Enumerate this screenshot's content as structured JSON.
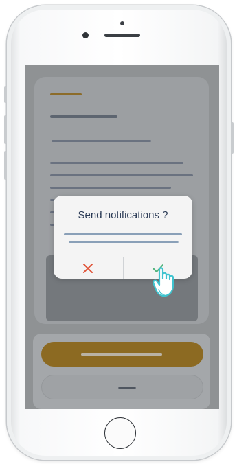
{
  "device": {
    "type": "smartphone",
    "frame_color": "#f2f3f4",
    "screen_overlay_color": "#8f9294"
  },
  "dialog": {
    "title": "Send notifications ?",
    "cancel_icon": "close-icon",
    "confirm_icon": "check-icon",
    "cancel_color": "#e0553a",
    "confirm_color": "#4fb27a"
  },
  "pointer": {
    "icon": "hand-pointer-icon",
    "color": "#3fc3cf"
  },
  "background_screen": {
    "accent_color": "#8c6c2a",
    "primary_button_color": "#8c6a22"
  }
}
